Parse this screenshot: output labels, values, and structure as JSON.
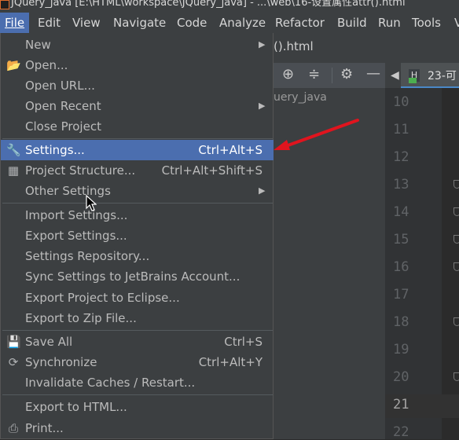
{
  "window": {
    "title": "JQuery_java [E:\\HTML\\workspace\\JQuery_java] - ...\\web\\16-设置属性attr().html"
  },
  "menubar": {
    "items": [
      {
        "id": "file",
        "label": "File"
      },
      {
        "id": "edit",
        "label": "Edit"
      },
      {
        "id": "view",
        "label": "View"
      },
      {
        "id": "navigate",
        "label": "Navigate"
      },
      {
        "id": "code",
        "label": "Code"
      },
      {
        "id": "analyze",
        "label": "Analyze"
      },
      {
        "id": "refactor",
        "label": "Refactor"
      },
      {
        "id": "build",
        "label": "Build"
      },
      {
        "id": "run",
        "label": "Run"
      },
      {
        "id": "tools",
        "label": "Tools"
      },
      {
        "id": "vcs",
        "label": "V"
      }
    ]
  },
  "file_tab": {
    "label": "().html"
  },
  "project_panel": {
    "root_label": "uery_java"
  },
  "editor_tab": {
    "label": "23-可"
  },
  "gutter": {
    "line_numbers": [
      "10",
      "11",
      "12",
      "13",
      "14",
      "15",
      "16",
      "17",
      "18",
      "19",
      "20",
      "21",
      "22"
    ],
    "current_line": "21"
  },
  "file_menu": {
    "items": [
      {
        "label": "New",
        "submenu": true
      },
      {
        "label": "Open...",
        "icon": "folder-icon"
      },
      {
        "label": "Open URL..."
      },
      {
        "label": "Open Recent",
        "submenu": true
      },
      {
        "label": "Close Project"
      },
      {
        "label": "Settings...",
        "shortcut": "Ctrl+Alt+S",
        "icon": "wrench-icon",
        "selected": true
      },
      {
        "label": "Project Structure...",
        "shortcut": "Ctrl+Alt+Shift+S",
        "icon": "project-structure-icon"
      },
      {
        "label": "Other Settings",
        "submenu": true
      },
      {
        "label": "Import Settings..."
      },
      {
        "label": "Export Settings..."
      },
      {
        "label": "Settings Repository..."
      },
      {
        "label": "Sync Settings to JetBrains Account..."
      },
      {
        "label": "Export Project to Eclipse..."
      },
      {
        "label": "Export to Zip File..."
      },
      {
        "label": "Save All",
        "shortcut": "Ctrl+S",
        "icon": "save-icon"
      },
      {
        "label": "Synchronize",
        "shortcut": "Ctrl+Alt+Y",
        "icon": "sync-icon"
      },
      {
        "label": "Invalidate Caches / Restart..."
      },
      {
        "label": "Export to HTML..."
      },
      {
        "label": "Print...",
        "icon": "print-icon"
      }
    ]
  },
  "colors": {
    "menu_bg": "#3c3f41",
    "selection": "#4b6eaf",
    "editor_bg": "#2b2b2b",
    "annotation_arrow": "#e0141e"
  }
}
